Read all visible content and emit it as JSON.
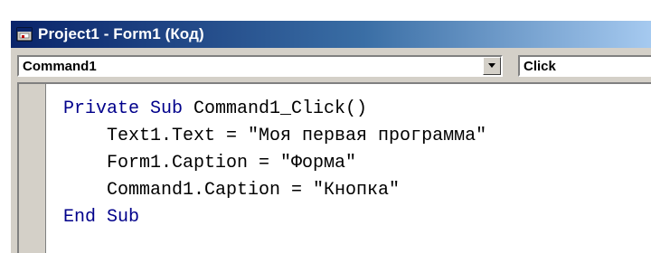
{
  "window": {
    "title": "Project1 - Form1 (Код)",
    "icon": "vb-form-icon"
  },
  "toolbar": {
    "object_combo": {
      "value": "Command1"
    },
    "procedure_combo": {
      "value": "Click"
    }
  },
  "code": {
    "lines": [
      [
        {
          "text": "Private Sub ",
          "kind": "keyword"
        },
        {
          "text": "Command1_Click()",
          "kind": "text"
        }
      ],
      [
        {
          "text": "    Text1.Text = \"Моя первая программа\"",
          "kind": "text"
        }
      ],
      [
        {
          "text": "    Form1.Caption = \"Форма\"",
          "kind": "text"
        }
      ],
      [
        {
          "text": "    Command1.Caption = \"Кнопка\"",
          "kind": "text"
        }
      ],
      [
        {
          "text": "End Sub",
          "kind": "keyword"
        }
      ]
    ]
  },
  "colors": {
    "keyword": "#00008b",
    "title_bar_start": "#0a246a",
    "title_bar_end": "#a6caf0",
    "chrome": "#d4d0c8"
  }
}
